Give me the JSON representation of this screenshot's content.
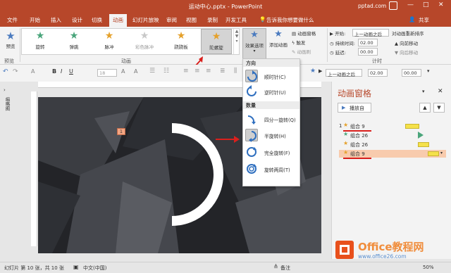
{
  "titlebar": {
    "title": "运动中心.pptx - PowerPoint",
    "site": "pptad.com",
    "min": "—",
    "max": "□",
    "close": "✕"
  },
  "tabs": [
    "文件",
    "开始",
    "插入",
    "设计",
    "切换",
    "动画",
    "幻灯片放映",
    "审阅",
    "视图",
    "录制",
    "开发工具"
  ],
  "tell_me": "告诉我你想要做什么",
  "share": "共享",
  "ribbon": {
    "preview": "预览",
    "preview_group": "预览",
    "animation_group": "动画",
    "timing_group": "计时",
    "gallery": [
      {
        "label": "旋转",
        "color": "#4aa57b"
      },
      {
        "label": "弹跳",
        "color": "#4aa57b"
      },
      {
        "label": "脉冲",
        "color": "#e5a12b"
      },
      {
        "label": "彩色脉冲",
        "color": "#c8c8c8"
      },
      {
        "label": "跷跷板",
        "color": "#e5a12b"
      },
      {
        "label": "陀螺旋",
        "color": "#e5a12b"
      }
    ],
    "effect_options": "效果选项",
    "add_animation": "添加动画",
    "animation_pane": "动画窗格",
    "trigger": "触发",
    "anim_painter": "动画刷",
    "start_label": "开始:",
    "start_value": "上一动画之后",
    "duration_label": "持续时间:",
    "duration_value": "02.00",
    "delay_label": "延迟:",
    "delay_value": "00.00",
    "reorder_title": "对动画重新排序",
    "move_earlier": "向前移动",
    "move_later": "向后移动"
  },
  "fmtbar": {
    "font_size": "18",
    "start_value": "上一动画之后",
    "duration_value": "02.00",
    "delay_value": "00.00"
  },
  "leftpane": {
    "label": "缩略图"
  },
  "slide": {
    "tag": "1"
  },
  "dropdown": {
    "direction_header": "方向",
    "items_dir": [
      "顺时针(C)",
      "逆时针(U)"
    ],
    "amount_header": "数量",
    "items_amt": [
      "四分一旋转(Q)",
      "半旋转(H)",
      "完全旋转(F)",
      "旋转两周(T)"
    ]
  },
  "animpane": {
    "title": "动画窗格",
    "play": "播放自",
    "up": "▲",
    "down": "▼",
    "rows": [
      {
        "num": "1",
        "name": "组合 9"
      },
      {
        "num": "",
        "name": "组合 26"
      },
      {
        "num": "",
        "name": "组合 26"
      },
      {
        "num": "",
        "name": "组合 9"
      }
    ],
    "colors": {
      "entrance": "#4aa57b",
      "emphasis": "#f5e14a",
      "highlight": "#f8cbad"
    }
  },
  "status": {
    "slide_info": "幻灯片 第 10 张，共 10 张",
    "language": "中文(中国)",
    "notes": "备注",
    "zoom": "50%"
  },
  "watermark": {
    "brand": "Office教程网",
    "url": "www.office26.com"
  }
}
